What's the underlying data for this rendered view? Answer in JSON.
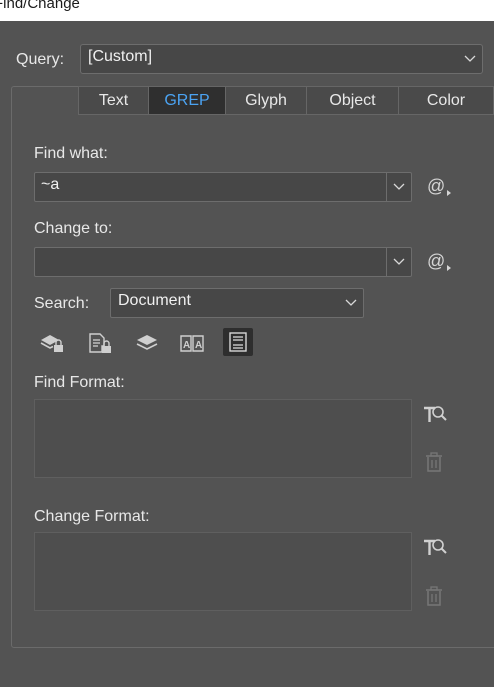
{
  "window": {
    "title": "Find/Change"
  },
  "query": {
    "label": "Query:",
    "value": "[Custom]"
  },
  "tabs": [
    {
      "label": "Text",
      "active": false
    },
    {
      "label": "GREP",
      "active": true
    },
    {
      "label": "Glyph",
      "active": false
    },
    {
      "label": "Object",
      "active": false
    },
    {
      "label": "Color",
      "active": false
    }
  ],
  "find": {
    "label": "Find what:",
    "value": "~a",
    "special_chars_icon": "at-sign-icon"
  },
  "change": {
    "label": "Change to:",
    "value": "",
    "special_chars_icon": "at-sign-icon"
  },
  "search": {
    "label": "Search:",
    "value": "Document"
  },
  "search_options": [
    {
      "name": "include-locked-layers-icon",
      "active": false
    },
    {
      "name": "include-locked-stories-icon",
      "active": false
    },
    {
      "name": "include-hidden-layers-icon",
      "active": false
    },
    {
      "name": "include-master-pages-icon",
      "active": false
    },
    {
      "name": "include-footnotes-icon",
      "active": true
    }
  ],
  "find_format": {
    "label": "Find Format:"
  },
  "change_format": {
    "label": "Change Format:"
  },
  "colors": {
    "background": "#535353",
    "active_tab_text": "#4ba3f2",
    "field_bg": "#474747"
  }
}
